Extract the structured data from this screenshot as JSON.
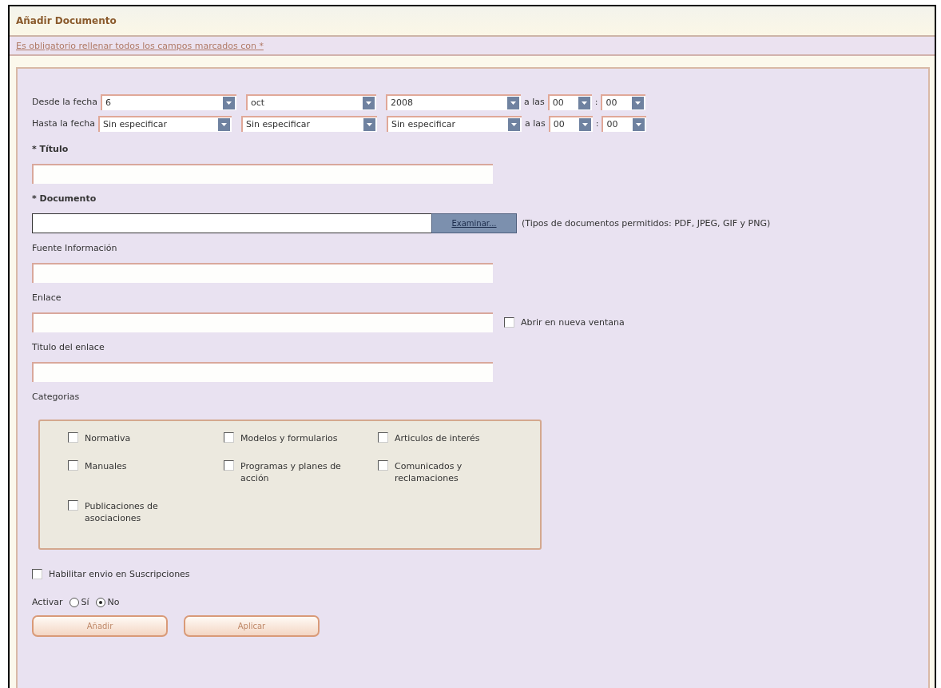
{
  "title": "Añadir Documento",
  "notice": "Es obligatorio rellenar todos los campos marcados con *",
  "date_rows": [
    {
      "label": "Desde la fecha",
      "day": "6",
      "month": "oct",
      "year": "2008",
      "at": "a las",
      "hour": "00",
      "separator": ":",
      "minute": "00"
    },
    {
      "label": "Hasta la fecha",
      "day": "Sin especificar",
      "month": "Sin especificar",
      "year": "Sin especificar",
      "at": "a las",
      "hour": "00",
      "separator": ":",
      "minute": "00"
    }
  ],
  "fields": [
    {
      "kind": "text",
      "label": "* Título",
      "required": true
    },
    {
      "kind": "file",
      "label": "* Documento",
      "required": true,
      "button": "Examinar...",
      "hint": "(Tipos de documentos permitidos: PDF, JPEG, GIF y PNG)"
    },
    {
      "kind": "text",
      "label": "Fuente Información",
      "required": false
    },
    {
      "kind": "text",
      "label": "Enlace",
      "required": false,
      "option": {
        "label": "Abrir en nueva ventana",
        "checked": false
      }
    },
    {
      "kind": "text",
      "label": "Titulo del enlace",
      "required": false
    }
  ],
  "categories": {
    "label": "Categorias",
    "items": [
      {
        "label": "Normativa",
        "checked": false
      },
      {
        "label": "Modelos y formularios",
        "checked": false
      },
      {
        "label": "Articulos de interés",
        "checked": false
      },
      {
        "label": "Manuales",
        "checked": false
      },
      {
        "label": "Programas y planes de acción",
        "checked": false
      },
      {
        "label": "Comunicados y reclamaciones",
        "checked": false
      },
      {
        "label": "Publicaciones de asociaciones",
        "checked": false
      }
    ]
  },
  "subscription": {
    "label": "Habilitar envio en Suscripciones",
    "checked": false
  },
  "activate": {
    "label": "Activar",
    "options": [
      {
        "label": "Sí",
        "selected": false
      },
      {
        "label": "No",
        "selected": true
      }
    ]
  },
  "buttons": [
    "Añadir",
    "Aplicar"
  ]
}
